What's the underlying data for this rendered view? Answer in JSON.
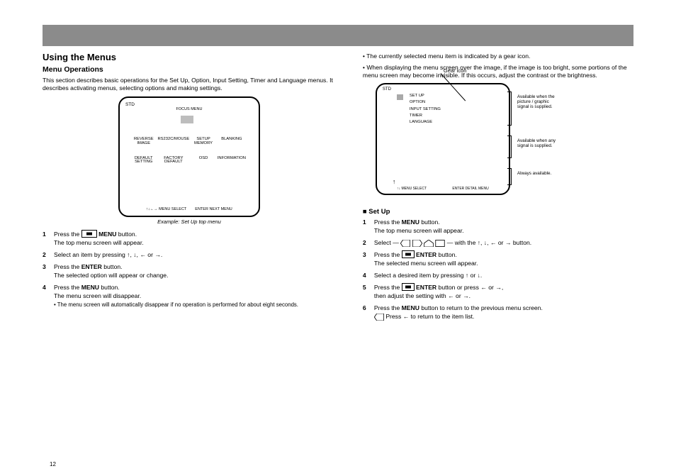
{
  "page_number": "12",
  "header": {
    "title": "Using the Menus",
    "subtitle": "Menu Operations"
  },
  "left": {
    "p1": "This section describes basic operations for the Set Up, Option, Input Setting, Timer and Language menus. It describes activating menus, selecting options and making settings.",
    "screen": {
      "badge": "STD",
      "label_focus": "FOCUS MENU",
      "gear_caption": "",
      "grid": [
        "REVERSE IMAGE",
        "RS232C/MOUSE",
        "SETUP MEMORY",
        "BLANKING",
        "DEFAULT SETTING",
        "FACTORY DEFAULT",
        "OSD",
        "INFORMATION"
      ],
      "hint_a": "↑↓←→  MENU SELECT",
      "hint_b": "ENTER  NEXT MENU"
    },
    "steps": [
      {
        "num": "1",
        "text_a": "Press the",
        "btn": "MENU",
        "text_b": "button.",
        "cont": "The top menu screen will appear."
      },
      {
        "num": "2",
        "text": "Select an item by pressing ↑, ↓, ← or →."
      },
      {
        "num": "3",
        "text_a": "Press the",
        "btn": "ENTER",
        "text_b": "button.",
        "cont": "The selected option will appear or change."
      },
      {
        "num": "4",
        "text_a": "Press the",
        "btn": "MENU",
        "text_b": "button.",
        "cont": "The menu screen will disappear.",
        "note": "• The menu screen will automatically disappear if no operation is performed for about eight seconds."
      }
    ]
  },
  "right": {
    "note_a": "• The currently selected menu item is indicated by a gear icon.",
    "note_b": "• When displaying the menu screen over the image, if the image is too bright, some portions of the menu screen may become invisible. If this occurs, adjust the contrast or the brightness.",
    "pointer_label": "Gear icon",
    "screen": {
      "badge": "STD",
      "title_row": "SET UP",
      "items": [
        "SET UP",
        "OPTION",
        "INPUT SETTING",
        "TIMER",
        "LANGUAGE"
      ],
      "hint_a": "↑↓  MENU SELECT",
      "hint_b": "ENTER  DETAIL MENU"
    },
    "brace_a": "Available when the picture / graphic signal is supplied.",
    "brace_b": "Available when any signal is supplied.",
    "brace_c": "Always available.",
    "h_setup": "■ Set Up",
    "setup_steps": [
      {
        "num": "1",
        "text_a": "Press the",
        "btn": "MENU",
        "text_b": "button.",
        "cont": "The top menu screen will appear."
      },
      {
        "num": "2",
        "text_pre": "Select — ",
        "icons": true,
        "text_post": " — with the ↑, ↓, ← or → button."
      },
      {
        "num": "3",
        "text_a": "Press the",
        "btn": "ENTER",
        "text_b": "button.",
        "cont": "The selected menu screen will appear."
      },
      {
        "num": "4",
        "text": "Select a desired item by pressing ↑ or ↓."
      },
      {
        "num": "5",
        "text_a": "Press the",
        "btn": "ENTER",
        "text_b": "button  or  press  ← or →,",
        "cont": "then adjust the setting with ← or →."
      },
      {
        "num": "6",
        "text_a": "Press the",
        "btn": "MENU",
        "text_b": "button to return to the previous menu screen.",
        "cont": "Press ← to return to the item list."
      }
    ]
  }
}
